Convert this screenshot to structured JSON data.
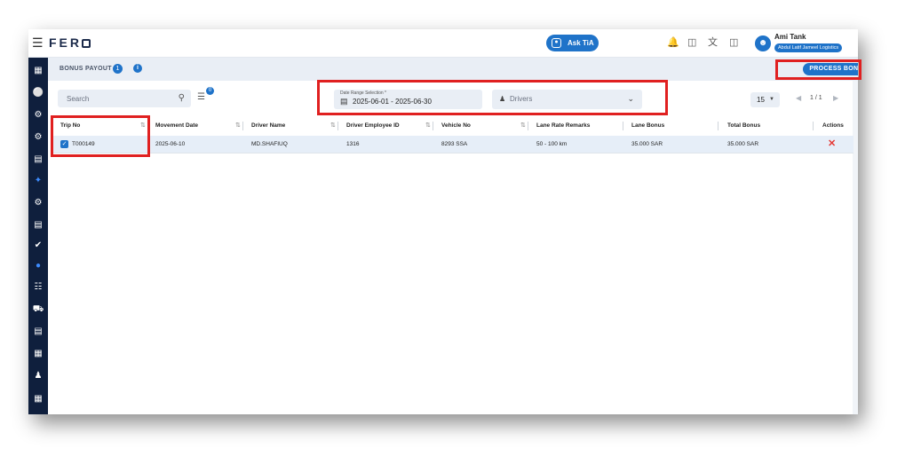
{
  "app": {
    "logo_text": "FER",
    "ask_label": "Ask TiA",
    "user_name": "Ami Tank",
    "company": "Abdul Latif Jameel Logistics"
  },
  "topbar_icons": [
    "notification-icon",
    "chat-icon",
    "translate-icon",
    "layout-icon"
  ],
  "page": {
    "title": "BONUS PAYOUT",
    "count": "1",
    "info": "i",
    "process_button": "PROCESS BONUS"
  },
  "filters": {
    "search_placeholder": "Search",
    "filter_badge": "0",
    "date_label": "Date Range Selection *",
    "date_value": "2025-06-01 - 2025-06-30",
    "drivers_placeholder": "Drivers",
    "per_page": "15",
    "pagination": "1 / 1"
  },
  "table": {
    "headers": {
      "trip_no": "Trip No",
      "movement_date": "Movement Date",
      "driver_name": "Driver Name",
      "driver_employee_id": "Driver Employee ID",
      "vehicle_no": "Vehicle No",
      "lane_rate_remarks": "Lane Rate Remarks",
      "lane_bonus": "Lane Bonus",
      "total_bonus": "Total Bonus",
      "actions": "Actions"
    },
    "rows": [
      {
        "trip_no": "T000149",
        "movement_date": "2025-06-10",
        "driver_name": "MD.SHAFIUQ",
        "driver_employee_id": "1316",
        "vehicle_no": "8293 SSA",
        "lane_rate_remarks": "50 - 100 km",
        "lane_bonus": "35.000 SAR",
        "total_bonus": "35.000 SAR"
      }
    ]
  },
  "colors": {
    "primary": "#1f73c9",
    "sidebar": "#0f1f3d",
    "highlight": "#e02020",
    "delete": "#e53935"
  }
}
